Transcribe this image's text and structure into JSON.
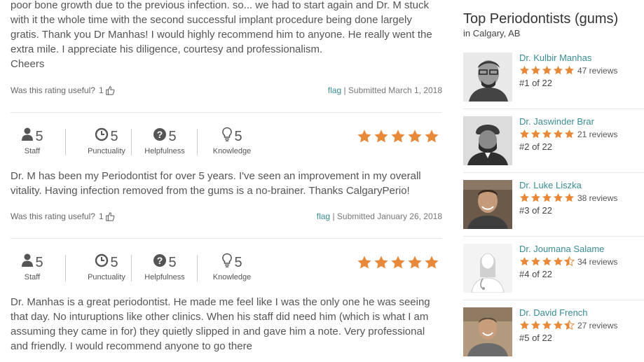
{
  "reviews": [
    {
      "text_lines": [
        "poor bone growth due to the previous infection. so... we had to start again and Dr. M stuck",
        "with it the whole time with the second successful implant procedure being done largely",
        "gratis. Thank you Dr Manhas! I would highly recommend him to anyone. He really went the",
        "extra mile. I appreciate his diligence, courtesy and professionalism.",
        "Cheers"
      ],
      "useful_label": "Was this rating useful?",
      "useful_count": "1",
      "flag": "flag",
      "submitted": "Submitted March 1, 2018"
    },
    {
      "ratings": [
        {
          "icon": "staff-icon",
          "value": "5",
          "label": "Staff"
        },
        {
          "icon": "punctuality-icon",
          "value": "5",
          "label": "Punctuality"
        },
        {
          "icon": "helpfulness-icon",
          "value": "5",
          "label": "Helpfulness"
        },
        {
          "icon": "knowledge-icon",
          "value": "5",
          "label": "Knowledge"
        }
      ],
      "stars": 5,
      "text_lines": [
        "Dr. M has been my Periodontist for over 5 years. I've seen an improvement in my overall",
        "vitality. Having infection removed from the gums is a no-brainer. Thanks CalgaryPerio!"
      ],
      "useful_label": "Was this rating useful?",
      "useful_count": "1",
      "flag": "flag",
      "submitted": "Submitted January 26, 2018"
    },
    {
      "ratings": [
        {
          "icon": "staff-icon",
          "value": "5",
          "label": "Staff"
        },
        {
          "icon": "punctuality-icon",
          "value": "5",
          "label": "Punctuality"
        },
        {
          "icon": "helpfulness-icon",
          "value": "5",
          "label": "Helpfulness"
        },
        {
          "icon": "knowledge-icon",
          "value": "5",
          "label": "Knowledge"
        }
      ],
      "stars": 5,
      "text_lines": [
        "Dr. Manhas is a great periodontist. He made me feel like I was the only one he was seeing",
        "that day. No inturuptions like other clinics. When his staff did need him (which is what I am",
        "assuming they came in for) they quietly slipped in and gave him a note. Very professional",
        "and friendly. I would recommend anyone to go there"
      ]
    }
  ],
  "sidebar": {
    "title": "Top Periodontists (gums)",
    "location": "in Calgary, AB",
    "doctors": [
      {
        "name": "Dr. Kulbir Manhas",
        "rating": 5,
        "reviews": "47 reviews",
        "rank": "#1 of 22"
      },
      {
        "name": "Dr. Jaswinder Brar",
        "rating": 5,
        "reviews": "21 reviews",
        "rank": "#2 of 22"
      },
      {
        "name": "Dr. Luke Liszka",
        "rating": 5,
        "reviews": "38 reviews",
        "rank": "#3 of 22"
      },
      {
        "name": "Dr. Joumana Salame",
        "rating": 4.5,
        "reviews": "34 reviews",
        "rank": "#4 of 22"
      },
      {
        "name": "Dr. David French",
        "rating": 4.5,
        "reviews": "27 reviews",
        "rank": "#5 of 22"
      }
    ]
  },
  "colors": {
    "star": "#e8893a",
    "link": "#3a8c93",
    "text": "#555555"
  }
}
